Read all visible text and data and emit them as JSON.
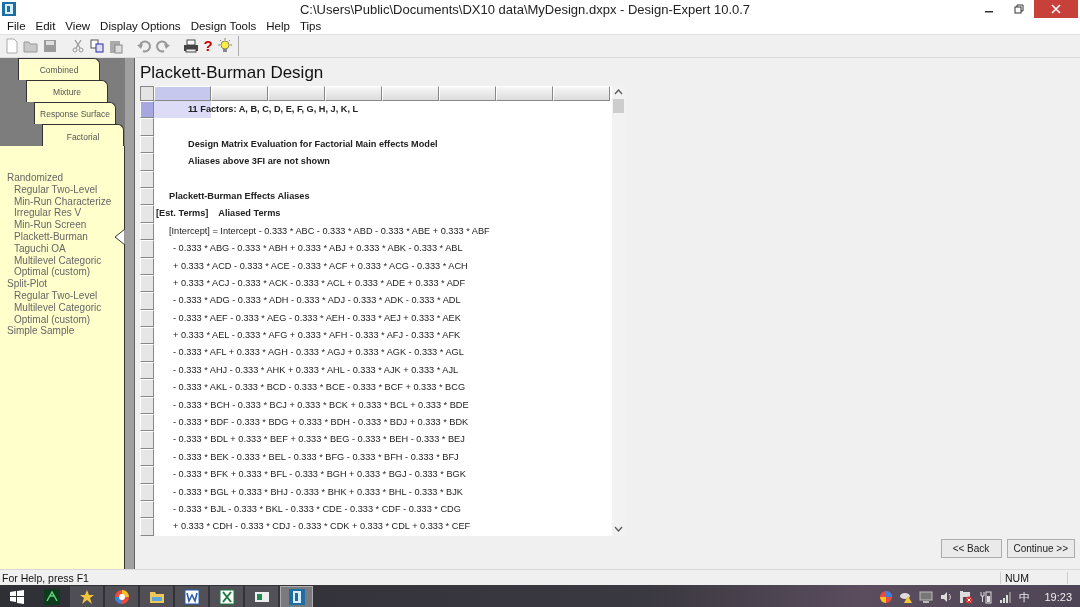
{
  "window": {
    "title": "C:\\Users\\Public\\Documents\\DX10 data\\MyDesign.dxpx - Design-Expert 10.0.7"
  },
  "menu": [
    "File",
    "Edit",
    "View",
    "Display Options",
    "Design Tools",
    "Help",
    "Tips"
  ],
  "toolbar": {
    "help_glyph": "?"
  },
  "design_tabs": [
    {
      "label": "Combined",
      "selected": false
    },
    {
      "label": "Mixture",
      "selected": false
    },
    {
      "label": "Response Surface",
      "selected": false
    },
    {
      "label": "Factorial",
      "selected": true
    }
  ],
  "design_tree": [
    {
      "label": "Randomized",
      "selected": false,
      "children": [
        {
          "label": "Regular Two-Level",
          "selected": false
        },
        {
          "label": "Min-Run Characterize",
          "selected": false
        },
        {
          "label": "Irregular Res V",
          "selected": false
        },
        {
          "label": "Min-Run Screen",
          "selected": false
        },
        {
          "label": "Plackett-Burman",
          "selected": true
        },
        {
          "label": "Taguchi OA",
          "selected": false
        },
        {
          "label": "Multilevel Categoric",
          "selected": false
        },
        {
          "label": "Optimal (custom)",
          "selected": false
        }
      ]
    },
    {
      "label": "Split-Plot",
      "selected": false,
      "children": [
        {
          "label": "Regular Two-Level",
          "selected": false
        },
        {
          "label": "Multilevel Categoric",
          "selected": false
        },
        {
          "label": "Optimal (custom)",
          "selected": false
        }
      ]
    },
    {
      "label": "Simple Sample",
      "selected": false
    }
  ],
  "page_title": "Plackett-Burman Design",
  "grid": {
    "columns": [
      {
        "selected": true
      },
      {
        "selected": false
      },
      {
        "selected": false
      },
      {
        "selected": false
      },
      {
        "selected": false
      },
      {
        "selected": false
      },
      {
        "selected": false
      },
      {
        "selected": false
      }
    ],
    "rows": [
      {
        "kind": "factors",
        "text": "11 Factors: A, B, C, D, E, F, G, H, J, K, L",
        "selected": true
      },
      {
        "kind": "blank",
        "selected": false
      },
      {
        "kind": "heading",
        "text": "Design Matrix Evaluation for Factorial Main effects Model",
        "selected": false
      },
      {
        "kind": "heading",
        "text": "Aliases above 3FI are not shown",
        "selected": false
      },
      {
        "kind": "blank",
        "selected": false
      },
      {
        "kind": "section",
        "text": "Plackett-Burman Effects Aliases",
        "selected": false
      },
      {
        "kind": "columns",
        "text": "[Est. Terms]    Aliased Terms",
        "selected": false
      },
      {
        "kind": "intercept",
        "text": "[Intercept] = Intercept - 0.333 * ABC - 0.333 * ABD - 0.333 * ABE + 0.333 * ABF",
        "selected": false
      },
      {
        "kind": "term",
        "text": "- 0.333 * ABG - 0.333 * ABH + 0.333 * ABJ + 0.333 * ABK - 0.333 * ABL",
        "selected": false
      },
      {
        "kind": "term",
        "text": "+ 0.333 * ACD - 0.333 * ACE - 0.333 * ACF + 0.333 * ACG - 0.333 * ACH",
        "selected": false
      },
      {
        "kind": "term",
        "text": "+ 0.333 * ACJ - 0.333 * ACK - 0.333 * ACL + 0.333 * ADE + 0.333 * ADF",
        "selected": false
      },
      {
        "kind": "term",
        "text": "- 0.333 * ADG - 0.333 * ADH - 0.333 * ADJ - 0.333 * ADK - 0.333 * ADL",
        "selected": false
      },
      {
        "kind": "term",
        "text": "- 0.333 * AEF - 0.333 * AEG - 0.333 * AEH - 0.333 * AEJ + 0.333 * AEK",
        "selected": false
      },
      {
        "kind": "term",
        "text": "+ 0.333 * AEL - 0.333 * AFG + 0.333 * AFH - 0.333 * AFJ - 0.333 * AFK",
        "selected": false
      },
      {
        "kind": "term",
        "text": "- 0.333 * AFL + 0.333 * AGH - 0.333 * AGJ + 0.333 * AGK - 0.333 * AGL",
        "selected": false
      },
      {
        "kind": "term",
        "text": "- 0.333 * AHJ - 0.333 * AHK + 0.333 * AHL - 0.333 * AJK + 0.333 * AJL",
        "selected": false
      },
      {
        "kind": "term",
        "text": "- 0.333 * AKL - 0.333 * BCD - 0.333 * BCE - 0.333 * BCF + 0.333 * BCG",
        "selected": false
      },
      {
        "kind": "term",
        "text": "- 0.333 * BCH - 0.333 * BCJ + 0.333 * BCK + 0.333 * BCL + 0.333 * BDE",
        "selected": false
      },
      {
        "kind": "term",
        "text": "- 0.333 * BDF - 0.333 * BDG + 0.333 * BDH - 0.333 * BDJ + 0.333 * BDK",
        "selected": false
      },
      {
        "kind": "term",
        "text": "- 0.333 * BDL + 0.333 * BEF + 0.333 * BEG - 0.333 * BEH - 0.333 * BEJ",
        "selected": false
      },
      {
        "kind": "term",
        "text": "- 0.333 * BEK - 0.333 * BEL - 0.333 * BFG - 0.333 * BFH - 0.333 * BFJ",
        "selected": false
      },
      {
        "kind": "term",
        "text": "- 0.333 * BFK + 0.333 * BFL - 0.333 * BGH + 0.333 * BGJ - 0.333 * BGK",
        "selected": false
      },
      {
        "kind": "term",
        "text": "- 0.333 * BGL + 0.333 * BHJ - 0.333 * BHK + 0.333 * BHL - 0.333 * BJK",
        "selected": false
      },
      {
        "kind": "term",
        "text": "- 0.333 * BJL - 0.333 * BKL - 0.333 * CDE - 0.333 * CDF - 0.333 * CDG",
        "selected": false
      },
      {
        "kind": "term",
        "text": "+ 0.333 * CDH - 0.333 * CDJ - 0.333 * CDK + 0.333 * CDL + 0.333 * CEF",
        "selected": false
      }
    ]
  },
  "buttons": [
    "<< Back",
    "Continue >>"
  ],
  "status_bar": {
    "message": "For Help, press F1",
    "indicator": "NUM"
  },
  "taskbar": {
    "ime": "中",
    "clock": "19:23"
  }
}
